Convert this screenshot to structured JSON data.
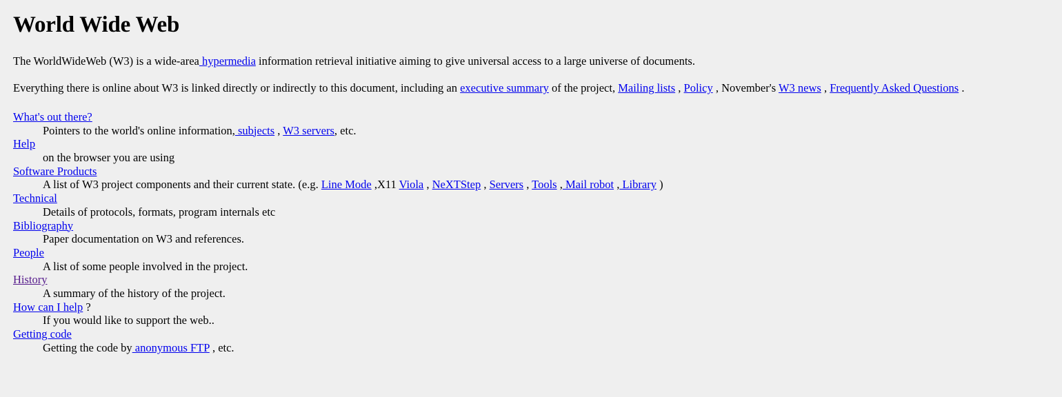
{
  "page": {
    "title": "World Wide Web",
    "background_color": "#efefef",
    "link_color": "#0000ee",
    "visited_link_color": "#551a8b",
    "text_color": "#000000"
  },
  "intro": {
    "p1_a": "The WorldWideWeb (W3) is a wide-area",
    "p1_link_hypermedia": " hypermedia",
    "p1_b": " information retrieval initiative aiming to give universal access to a large universe of documents.",
    "p2_a": "Everything there is online about W3 is linked directly or indirectly to this document, including an ",
    "p2_link_executive_summary": "executive summary",
    "p2_b": " of the project, ",
    "p2_link_mailing_lists": "Mailing lists",
    "p2_c": " , ",
    "p2_link_policy": "Policy",
    "p2_d": " , November's ",
    "p2_link_w3_news": "W3 news",
    "p2_e": " , ",
    "p2_link_faq": "Frequently Asked Questions",
    "p2_f": " ."
  },
  "index": [
    {
      "term": "What's out there?",
      "term_visited": false,
      "def_parts": [
        {
          "text": "Pointers to the world's online information,",
          "link": false
        },
        {
          "text": " subjects",
          "link": true,
          "visited": false
        },
        {
          "text": " , ",
          "link": false
        },
        {
          "text": "W3 servers",
          "link": true,
          "visited": false
        },
        {
          "text": ", etc.",
          "link": false
        }
      ]
    },
    {
      "term": "Help",
      "term_visited": false,
      "def_parts": [
        {
          "text": "on the browser you are using",
          "link": false
        }
      ]
    },
    {
      "term": "Software Products",
      "term_visited": false,
      "def_parts": [
        {
          "text": "A list of W3 project components and their current state. (e.g. ",
          "link": false
        },
        {
          "text": "Line Mode",
          "link": true,
          "visited": false
        },
        {
          "text": " ,X11 ",
          "link": false
        },
        {
          "text": "Viola",
          "link": true,
          "visited": false
        },
        {
          "text": " , ",
          "link": false
        },
        {
          "text": "NeXTStep",
          "link": true,
          "visited": false
        },
        {
          "text": " , ",
          "link": false
        },
        {
          "text": "Servers",
          "link": true,
          "visited": false
        },
        {
          "text": " , ",
          "link": false
        },
        {
          "text": "Tools",
          "link": true,
          "visited": false
        },
        {
          "text": " ,",
          "link": false
        },
        {
          "text": " Mail robot",
          "link": true,
          "visited": false
        },
        {
          "text": " ,",
          "link": false
        },
        {
          "text": " Library",
          "link": true,
          "visited": false
        },
        {
          "text": " )",
          "link": false
        }
      ]
    },
    {
      "term": "Technical",
      "term_visited": false,
      "def_parts": [
        {
          "text": "Details of protocols, formats, program internals etc",
          "link": false
        }
      ]
    },
    {
      "term": "Bibliography",
      "term_visited": false,
      "def_parts": [
        {
          "text": "Paper documentation on W3 and references.",
          "link": false
        }
      ]
    },
    {
      "term": "People",
      "term_visited": false,
      "def_parts": [
        {
          "text": "A list of some people involved in the project.",
          "link": false
        }
      ]
    },
    {
      "term": "History",
      "term_visited": true,
      "def_parts": [
        {
          "text": "A summary of the history of the project.",
          "link": false
        }
      ]
    },
    {
      "term": "How can I help",
      "term_visited": false,
      "term_suffix": " ?",
      "def_parts": [
        {
          "text": "If you would like to support the web..",
          "link": false
        }
      ]
    },
    {
      "term": "Getting code",
      "term_visited": false,
      "def_parts": [
        {
          "text": "Getting the code by",
          "link": false
        },
        {
          "text": " anonymous FTP",
          "link": true,
          "visited": false
        },
        {
          "text": " , etc.",
          "link": false
        }
      ]
    }
  ]
}
